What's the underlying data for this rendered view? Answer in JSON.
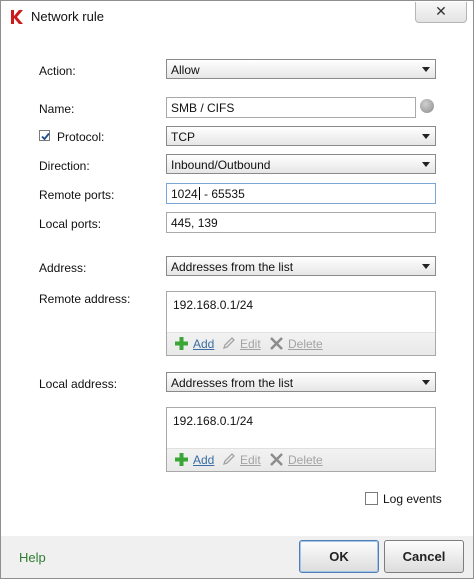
{
  "window": {
    "title": "Network rule",
    "close_glyph": "✕"
  },
  "form": {
    "action": {
      "label": "Action:",
      "value": "Allow"
    },
    "name": {
      "label": "Name:",
      "value": "SMB / CIFS"
    },
    "protocol": {
      "label": "Protocol:",
      "checked": true,
      "value": "TCP"
    },
    "direction": {
      "label": "Direction:",
      "value": "Inbound/Outbound"
    },
    "remote_ports": {
      "label": "Remote ports:",
      "value_before_caret": "1024",
      "value_after_caret": " - 65535"
    },
    "local_ports": {
      "label": "Local ports:",
      "value": "445, 139"
    },
    "address": {
      "label": "Address:",
      "value": "Addresses from the list"
    },
    "remote_address": {
      "label": "Remote address:",
      "items": [
        "192.168.0.1/24"
      ],
      "add_label": "Add",
      "edit_label": "Edit",
      "delete_label": "Delete"
    },
    "local_address": {
      "label": "Local address:",
      "select_value": "Addresses from the list",
      "items": [
        "192.168.0.1/24"
      ],
      "add_label": "Add",
      "edit_label": "Edit",
      "delete_label": "Delete"
    },
    "log_events": {
      "label": "Log events",
      "checked": false
    }
  },
  "footer": {
    "help_label": "Help",
    "ok_label": "OK",
    "cancel_label": "Cancel"
  },
  "icons": {
    "app": "kaspersky-k-icon",
    "info": "info-circle-icon",
    "add": "plus-icon",
    "edit": "pencil-icon",
    "delete": "x-icon"
  },
  "colors": {
    "help_link": "#2e7d32",
    "link": "#3a6ea5",
    "disabled": "#a3a3a3",
    "add_icon": "#3aa635"
  }
}
